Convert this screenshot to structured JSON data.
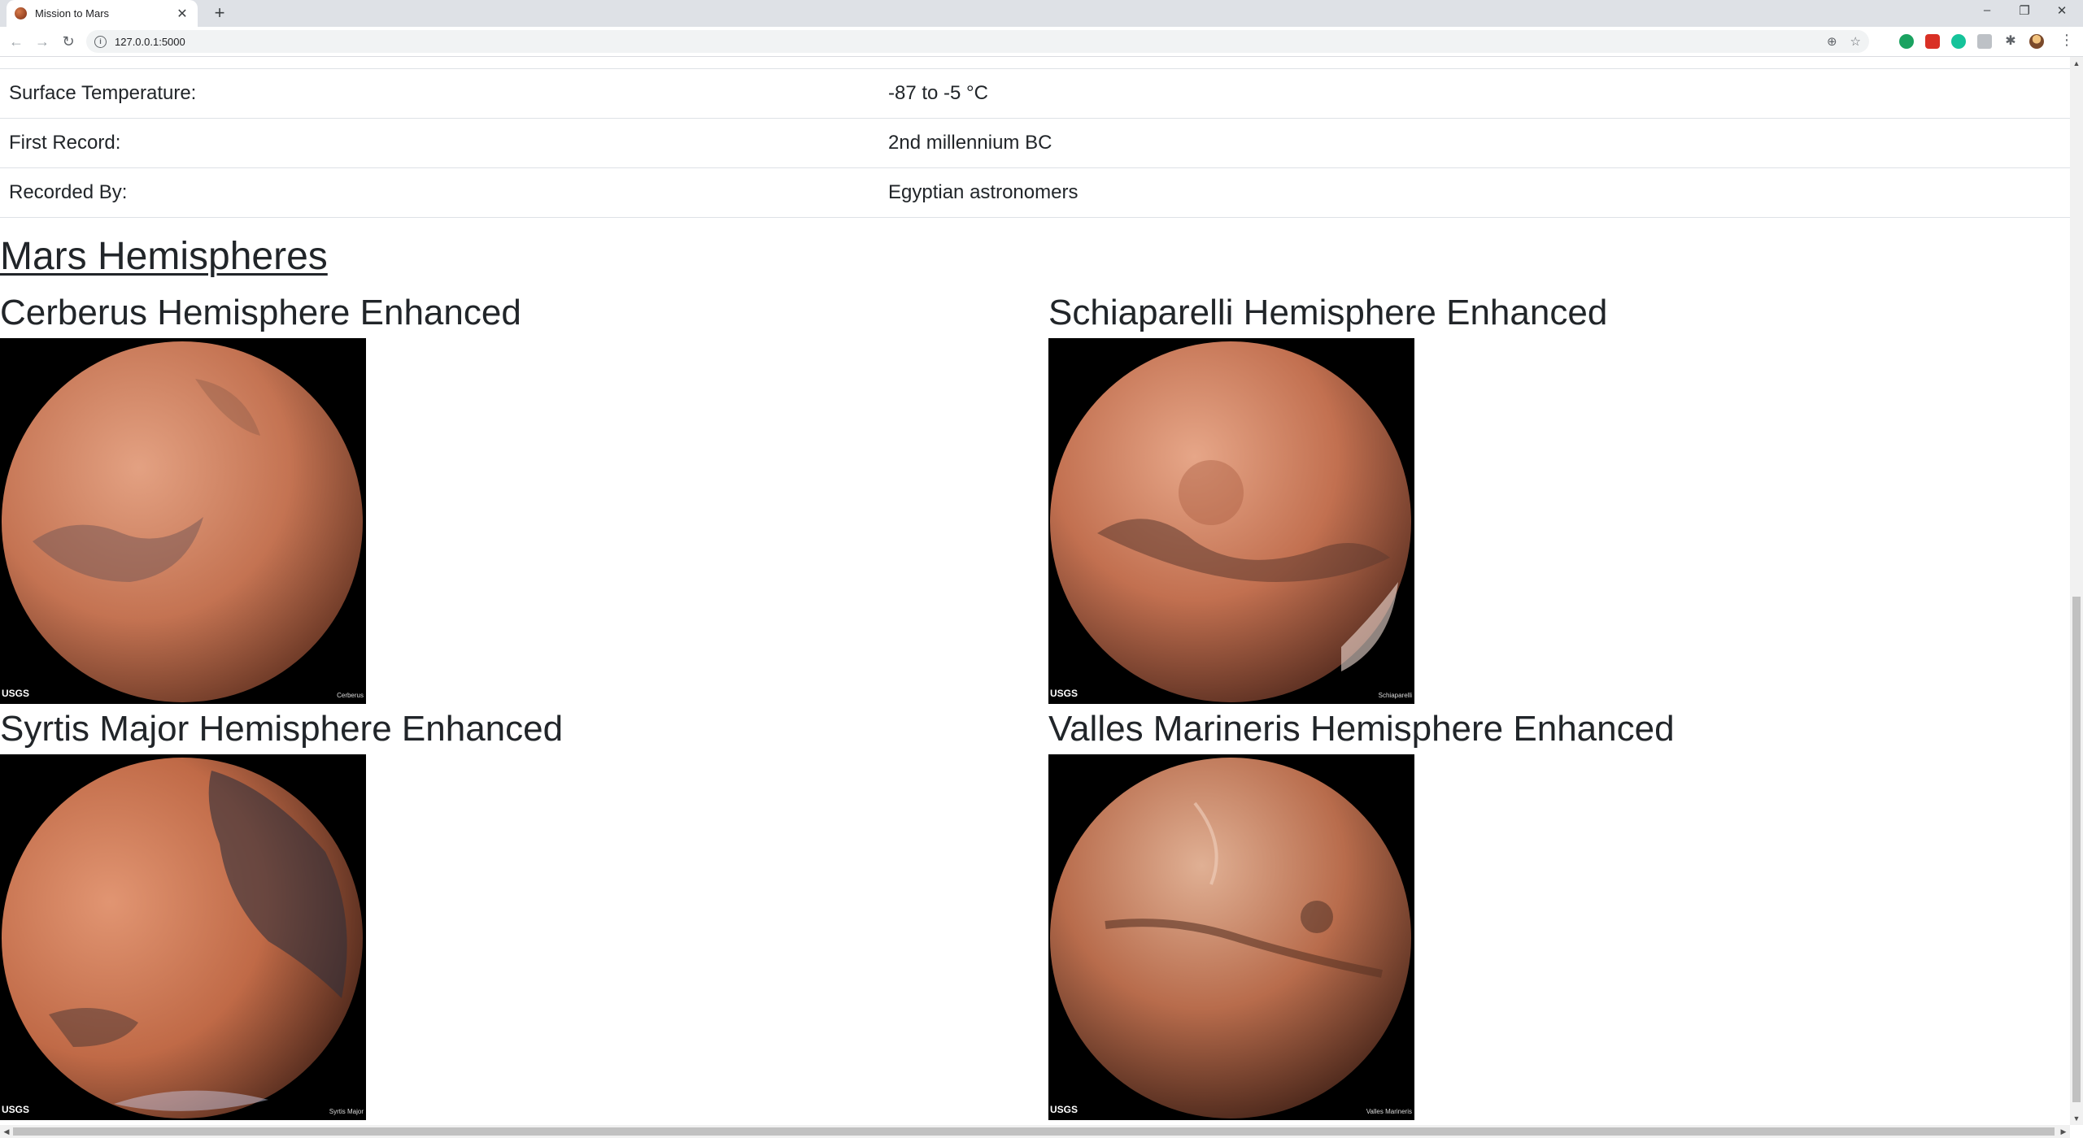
{
  "browser": {
    "tab_title": "Mission to Mars",
    "tab_close": "✕",
    "new_tab": "+",
    "url": "127.0.0.1:5000",
    "window_controls": {
      "minimize": "–",
      "maximize": "❐",
      "close": "✕"
    },
    "nav": {
      "back": "←",
      "forward": "→",
      "reload": "↻"
    },
    "omnibox_icons": {
      "zoom": "⊕",
      "bookmark": "☆"
    },
    "menu": "⋮"
  },
  "facts": [
    {
      "label": "Surface Temperature:",
      "value": "-87 to -5 °C"
    },
    {
      "label": "First Record:",
      "value": "2nd millennium BC"
    },
    {
      "label": "Recorded By:",
      "value": "Egyptian astronomers"
    }
  ],
  "hemispheres_section": {
    "title": "Mars Hemispheres",
    "items": [
      {
        "title": "Cerberus Hemisphere Enhanced",
        "logo": "USGS",
        "caption": "Cerberus"
      },
      {
        "title": "Schiaparelli Hemisphere Enhanced",
        "logo": "USGS",
        "caption": "Schiaparelli"
      },
      {
        "title": "Syrtis Major Hemisphere Enhanced",
        "logo": "USGS",
        "caption": "Syrtis Major"
      },
      {
        "title": "Valles Marineris Hemisphere Enhanced",
        "logo": "USGS",
        "caption": "Valles Marineris"
      }
    ]
  },
  "colors": {
    "mars_light": "#d98c6a",
    "mars_mid": "#b8684a",
    "mars_dark": "#5a3326",
    "text": "#212529",
    "chrome_bg": "#dee1e6"
  }
}
